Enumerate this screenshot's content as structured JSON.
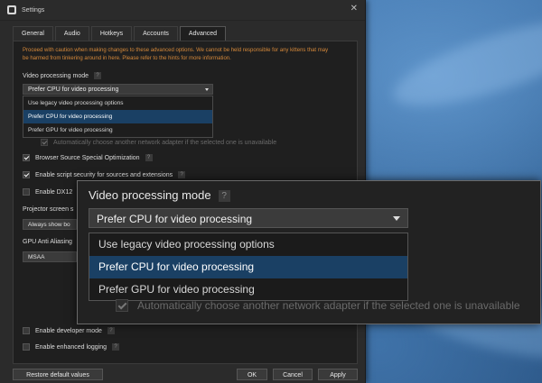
{
  "window": {
    "title": "Settings",
    "close_glyph": "✕"
  },
  "tabs": [
    "General",
    "Audio",
    "Hotkeys",
    "Accounts",
    "Advanced"
  ],
  "active_tab": "Advanced",
  "warning": "Proceed with caution when making changes to these advanced options. We cannot be held responsible for any kittens that may be harmed from tinkering around in here. Please refer to the hints for more information.",
  "video_processing": {
    "label": "Video processing mode",
    "selected": "Prefer CPU for video processing",
    "options": [
      "Use legacy video processing options",
      "Prefer CPU for video processing",
      "Prefer GPU for video processing"
    ]
  },
  "network_adapter_auto": {
    "label": "Automatically choose another network adapter if the selected one is unavailable",
    "checked": true,
    "disabled": true
  },
  "browser_source_opt": {
    "label": "Browser Source Special Optimization",
    "checked": true
  },
  "script_security": {
    "label": "Enable script security for sources and extensions",
    "checked": true
  },
  "enable_dx12": {
    "label": "Enable DX12",
    "checked": false
  },
  "projector": {
    "label": "Projector screen s",
    "value": "Always show bo"
  },
  "gpu_aa": {
    "label": "GPU Anti Aliasing",
    "value": "MSAA"
  },
  "developer_mode": {
    "label": "Enable developer mode",
    "checked": false
  },
  "enhanced_logging": {
    "label": "Enable enhanced logging",
    "checked": false
  },
  "buttons": {
    "restore": "Restore default values",
    "ok": "OK",
    "cancel": "Cancel",
    "apply": "Apply"
  },
  "help_glyph": "?",
  "colors": {
    "selection": "#1a4064",
    "warning": "#d6893a"
  }
}
